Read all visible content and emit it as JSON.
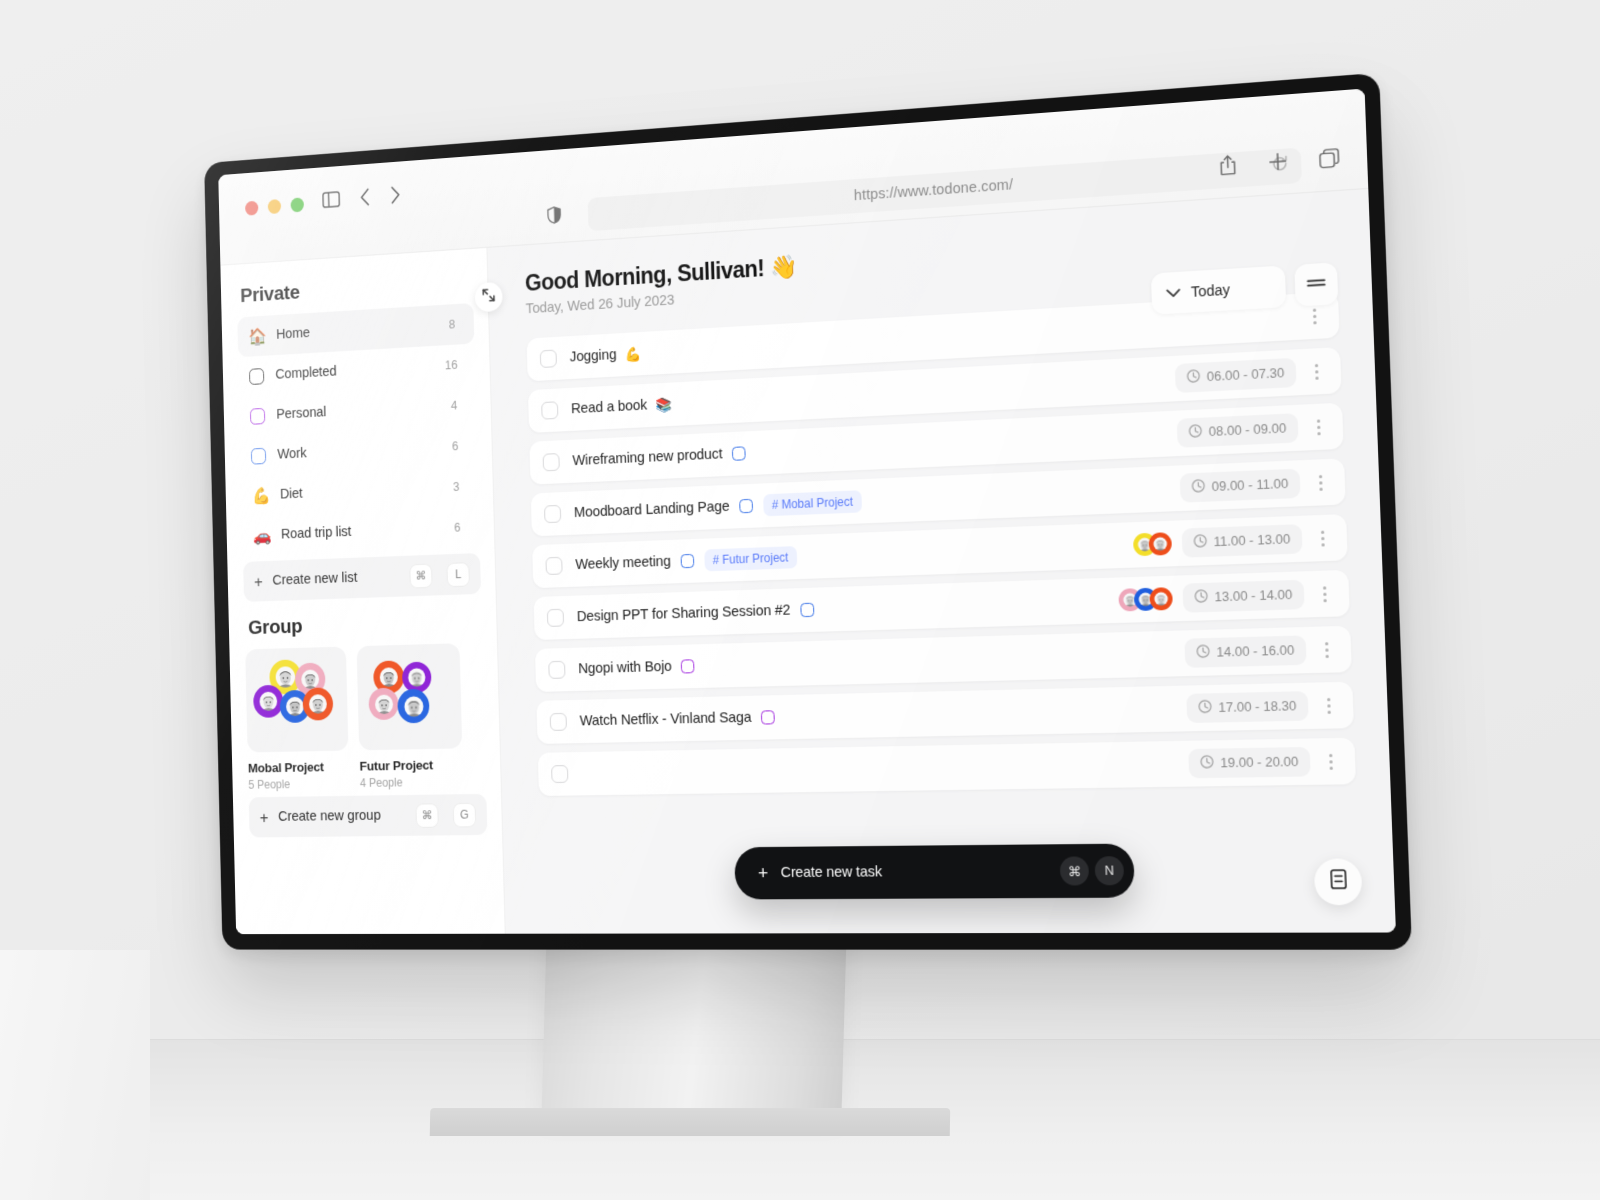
{
  "browser": {
    "url": "https://www.todone.com/",
    "traffic_lights": [
      "close",
      "minimize",
      "maximize"
    ],
    "icons": {
      "sidebar_toggle": "sidebar-toggle-icon",
      "back": "back-arrow-icon",
      "forward": "forward-arrow-icon",
      "shield": "shield-icon",
      "reload": "reload-icon",
      "share": "share-icon",
      "new_tab": "plus-icon",
      "tabs_overview": "tabs-overview-icon"
    }
  },
  "sidebar": {
    "private_title": "Private",
    "group_title": "Group",
    "collapse_icon": "collapse-icon",
    "lists": [
      {
        "label": "Home",
        "count": "8",
        "icon": "house-emoji",
        "emoji": "🏠",
        "kind": "emoji",
        "active": true
      },
      {
        "label": "Completed",
        "count": "16",
        "icon": "checkbox-black-icon",
        "kind": "checkbox",
        "color": "#2b2b2b"
      },
      {
        "label": "Personal",
        "count": "4",
        "icon": "checkbox-purple-icon",
        "kind": "checkbox",
        "color": "#a32ee0"
      },
      {
        "label": "Work",
        "count": "6",
        "icon": "checkbox-blue-icon",
        "kind": "checkbox",
        "color": "#3b74e8"
      },
      {
        "label": "Diet",
        "count": "3",
        "icon": "flexed-biceps-emoji",
        "emoji": "💪",
        "kind": "emoji"
      },
      {
        "label": "Road trip list",
        "count": "6",
        "icon": "car-emoji",
        "emoji": "🚗",
        "kind": "emoji"
      }
    ],
    "create_list": {
      "label": "Create new list",
      "shortcut_mod": "⌘",
      "shortcut_key": "L"
    },
    "create_group": {
      "label": "Create new group",
      "shortcut_mod": "⌘",
      "shortcut_key": "G"
    },
    "groups": [
      {
        "name": "Mobal Project",
        "people": "5 People",
        "avatar_colors": [
          "#f5e02a",
          "#f0a8bc",
          "#8a19d6",
          "#1f5fe0",
          "#f04e1b"
        ]
      },
      {
        "name": "Futur Project",
        "people": "4 People",
        "avatar_colors": [
          "#f04e1b",
          "#8a19d6",
          "#f0a8bc",
          "#1f5fe0"
        ]
      }
    ]
  },
  "main": {
    "greeting": "Good Morning, Sullivan!",
    "greeting_emoji": "👋",
    "subdate": "Today, Wed 26 July 2023",
    "filter": {
      "label": "Today",
      "chevron_icon": "chevron-down-icon",
      "sort_icon": "sort-lines-icon"
    },
    "tasks": [
      {
        "title": "Jogging",
        "emoji": "💪",
        "mark": null,
        "tag": null,
        "avatars": [],
        "time": null
      },
      {
        "title": "Read a book",
        "emoji": "📚",
        "mark": null,
        "tag": null,
        "avatars": [],
        "time": "06.00 - 07.30"
      },
      {
        "title": "Wireframing new product",
        "emoji": null,
        "mark": "blue",
        "tag": null,
        "avatars": [],
        "time": "08.00 - 09.00"
      },
      {
        "title": "Moodboard Landing Page",
        "emoji": null,
        "mark": "blue",
        "tag": "# Mobal Project",
        "avatars": [],
        "time": "09.00 - 11.00"
      },
      {
        "title": "Weekly meeting",
        "emoji": null,
        "mark": "blue",
        "tag": "# Futur Project",
        "avatars": [
          "#f5e02a",
          "#f04e1b"
        ],
        "time": "11.00 - 13.00"
      },
      {
        "title": "Design PPT for Sharing Session #2",
        "emoji": null,
        "mark": "blue",
        "tag": null,
        "avatars": [
          "#f0a8bc",
          "#1f5fe0",
          "#f04e1b"
        ],
        "time": "13.00 - 14.00"
      },
      {
        "title": "Ngopi with Bojo",
        "emoji": null,
        "mark": "purple",
        "tag": null,
        "avatars": [],
        "time": "14.00 - 16.00"
      },
      {
        "title": "Watch Netflix - Vinland Saga",
        "emoji": null,
        "mark": "purple",
        "tag": null,
        "avatars": [],
        "time": "17.00 - 18.30"
      },
      {
        "title": null,
        "emoji": null,
        "mark": null,
        "tag": null,
        "avatars": [],
        "time": "19.00 - 20.00"
      }
    ],
    "create_task": {
      "label": "Create new task",
      "shortcut_mod": "⌘",
      "shortcut_key": "N",
      "plus": "+"
    },
    "fab_icon": "document-icon"
  },
  "colors": {
    "accent_blue": "#5b7cfa",
    "tag_bg": "#eef2ff",
    "purple": "#a32ee0",
    "dark": "#111214"
  }
}
